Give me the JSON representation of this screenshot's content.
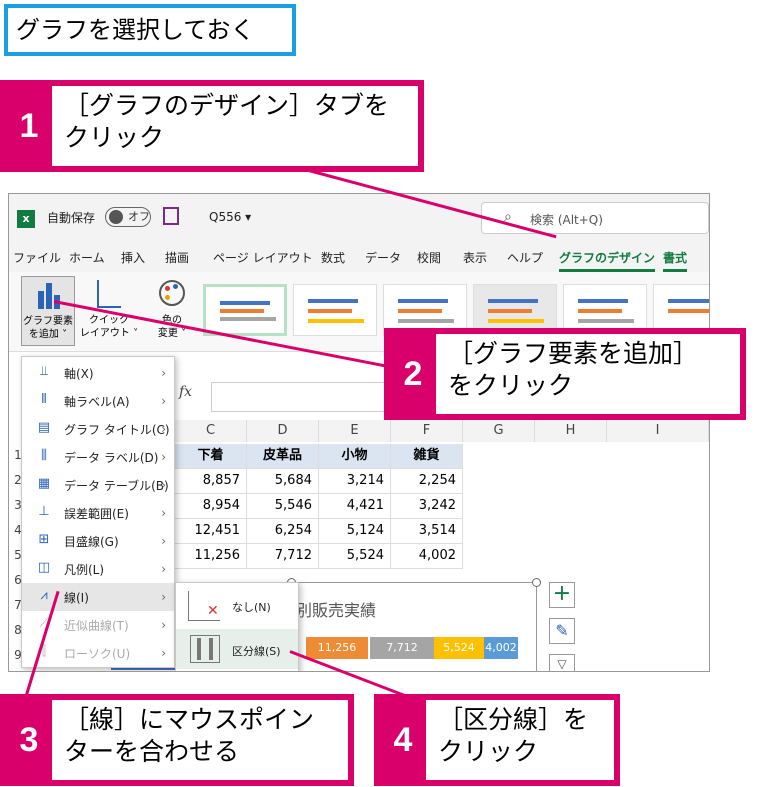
{
  "top_label": "グラフを選択しておく",
  "steps": [
    {
      "num": "1",
      "text": "［グラフのデザイン］タブを\nクリック"
    },
    {
      "num": "2",
      "text": "［グラフ要素を追加］\nをクリック"
    },
    {
      "num": "3",
      "text": "［線］にマウスポイン\nターを合わせる"
    },
    {
      "num": "4",
      "text": "［区分線］を\nクリック"
    }
  ],
  "titlebar": {
    "autosave": "自動保存",
    "toggle": "オフ",
    "filename": "Q556 ▾",
    "search_placeholder": "検索 (Alt+Q)"
  },
  "tabs": [
    "ファイル",
    "ホーム",
    "挿入",
    "描画",
    "ページ レイアウト",
    "数式",
    "データ",
    "校閲",
    "表示",
    "ヘルプ",
    "グラフのデザイン",
    "書式"
  ],
  "ribbon": {
    "add_element": "グラフ要素\nを追加 ˅",
    "quick_layout": "クイック\nレイアウト ˅",
    "colors": "色の\n変更 ˅",
    "fx": "fx"
  },
  "columns": [
    "C",
    "D",
    "E",
    "F",
    "G",
    "H",
    "I"
  ],
  "rows": [
    "1",
    "2",
    "3",
    "4",
    "5",
    "6",
    "7",
    "8",
    "9"
  ],
  "table": {
    "headers": [
      "下着",
      "皮革品",
      "小物",
      "雑貨"
    ],
    "data": [
      [
        "8,857",
        "5,684",
        "3,214",
        "2,254"
      ],
      [
        "8,954",
        "5,546",
        "4,421",
        "3,242"
      ],
      [
        "12,451",
        "6,254",
        "5,124",
        "3,514"
      ],
      [
        "11,256",
        "7,712",
        "5,524",
        "4,002"
      ]
    ]
  },
  "menu": [
    {
      "icon": "axes-icon",
      "label": "軸(X)"
    },
    {
      "icon": "axis-title-icon",
      "label": "軸ラベル(A)"
    },
    {
      "icon": "chart-title-icon",
      "label": "グラフ タイトル(C)"
    },
    {
      "icon": "data-label-icon",
      "label": "データ ラベル(D)"
    },
    {
      "icon": "data-table-icon",
      "label": "データ テーブル(B)"
    },
    {
      "icon": "error-bar-icon",
      "label": "誤差範囲(E)"
    },
    {
      "icon": "gridlines-icon",
      "label": "目盛線(G)"
    },
    {
      "icon": "legend-icon",
      "label": "凡例(L)"
    },
    {
      "icon": "lines-icon",
      "label": "線(I)"
    },
    {
      "icon": "trendline-icon",
      "label": "近似曲線(T)"
    },
    {
      "icon": "updown-bars-icon",
      "label": "ローソク(U)"
    }
  ],
  "submenu": [
    {
      "label": "なし(N)"
    },
    {
      "label": "区分線(S)"
    }
  ],
  "chart": {
    "title": "別販売実績",
    "bar_labels": [
      "11,256",
      "7,712",
      "5,524",
      "4,002"
    ]
  },
  "colors": {
    "accent": "#d9006c",
    "excel_green": "#107c41",
    "blue_label": "#1aa0e0"
  }
}
